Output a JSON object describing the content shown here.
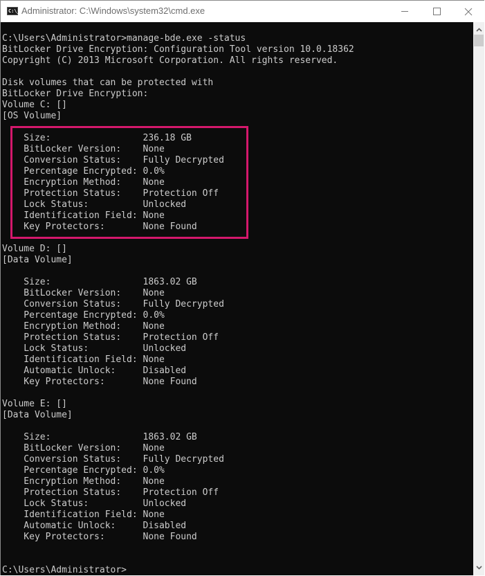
{
  "window": {
    "title": "Administrator: C:\\Windows\\system32\\cmd.exe",
    "icon": "cmd-icon",
    "icon_text": "C:\\_",
    "controls": [
      "minimize",
      "maximize",
      "close"
    ]
  },
  "console": {
    "lines": [
      "C:\\Users\\Administrator>manage-bde.exe -status",
      "BitLocker Drive Encryption: Configuration Tool version 10.0.18362",
      "Copyright (C) 2013 Microsoft Corporation. All rights reserved.",
      "",
      "Disk volumes that can be protected with",
      "BitLocker Drive Encryption:",
      "Volume C: []",
      "[OS Volume]",
      "",
      "    Size:                 236.18 GB",
      "    BitLocker Version:    None",
      "    Conversion Status:    Fully Decrypted",
      "    Percentage Encrypted: 0.0%",
      "    Encryption Method:    None",
      "    Protection Status:    Protection Off",
      "    Lock Status:          Unlocked",
      "    Identification Field: None",
      "    Key Protectors:       None Found",
      "",
      "Volume D: []",
      "[Data Volume]",
      "",
      "    Size:                 1863.02 GB",
      "    BitLocker Version:    None",
      "    Conversion Status:    Fully Decrypted",
      "    Percentage Encrypted: 0.0%",
      "    Encryption Method:    None",
      "    Protection Status:    Protection Off",
      "    Lock Status:          Unlocked",
      "    Identification Field: None",
      "    Automatic Unlock:     Disabled",
      "    Key Protectors:       None Found",
      "",
      "Volume E: []",
      "[Data Volume]",
      "",
      "    Size:                 1863.02 GB",
      "    BitLocker Version:    None",
      "    Conversion Status:    Fully Decrypted",
      "    Percentage Encrypted: 0.0%",
      "    Encryption Method:    None",
      "    Protection Status:    Protection Off",
      "    Lock Status:          Unlocked",
      "    Identification Field: None",
      "    Automatic Unlock:     Disabled",
      "    Key Protectors:       None Found",
      "",
      "",
      "C:\\Users\\Administrator>"
    ]
  },
  "highlight": {
    "color": "#d4186c",
    "target": "Volume C details"
  },
  "scrollbar": {
    "up_icon": "chevron-up-icon",
    "down_icon": "chevron-down-icon"
  },
  "colors": {
    "console_bg": "#0c0c0c",
    "console_fg": "#cccccc",
    "scrollbar_bg": "#f0f0f0"
  }
}
